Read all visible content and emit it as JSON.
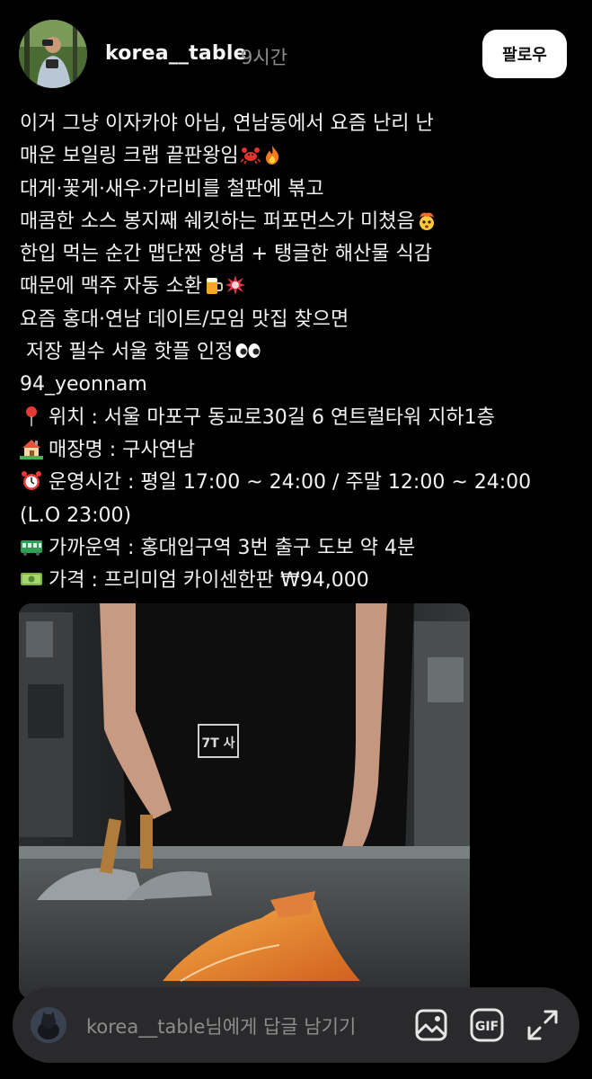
{
  "post": {
    "username": "korea__table",
    "timestamp": "9시간",
    "follow_label": "팔로우"
  },
  "caption": {
    "line1": "이거 그냥 이자카야 아님, 연남동에서 요즘 난리 난",
    "line2": "매운 보일링 크랩 끝판왕임",
    "line3": "대게·꽃게·새우·가리비를 철판에 볶고",
    "line4": "매콤한 소스 봉지째 쉐킷하는 퍼포먼스가 미쳤음",
    "line5": "한입 먹는 순간 맵단짠 양념 + 탱글한 해산물 식감",
    "line6": "때문에 맥주 자동 소환",
    "line7": "요즘 홍대·연남 데이트/모임 맛집 찾으면",
    "line8": " 저장 필수 서울 핫플 인정",
    "line9": "94_yeonnam",
    "location": "위치 : 서울 마포구 동교로30길 6 연트럴타워 지하1층",
    "store": "매장명 : 구사연남",
    "hours": "운영시간 : 평일 17:00 ~ 24:00 / 주말 12:00 ~ 24:00",
    "hours_lo": "(L.O 23:00)",
    "station": "가까운역 : 홍대입구역 3번 출구 도보 약 4분",
    "price": "가격 : 프리미엄 카이센한판 ₩94,000"
  },
  "photo": {
    "apron_text": "7T 사"
  },
  "reply": {
    "placeholder": "korea__table님에게 답글 남기기",
    "gif_label": "GIF"
  },
  "icons": {
    "avatar": "profile-photo",
    "crab": "crab-emoji",
    "fire": "fire-emoji",
    "exploding": "exploding-head-emoji",
    "beer": "beer-emoji",
    "collision": "collision-emoji",
    "eyes": "eyes-emoji",
    "pin": "round-pushpin-emoji",
    "house": "house-emoji",
    "clock": "alarm-clock-emoji",
    "tram": "tram-emoji",
    "money": "banknote-emoji",
    "image": "image-icon",
    "gif": "gif-icon",
    "expand": "expand-icon"
  },
  "colors": {
    "background": "#000000",
    "text": "#f2f2f2",
    "muted": "#8e8e8e",
    "follow_bg": "#ffffff",
    "reply_bar": "#2a2a2c"
  }
}
